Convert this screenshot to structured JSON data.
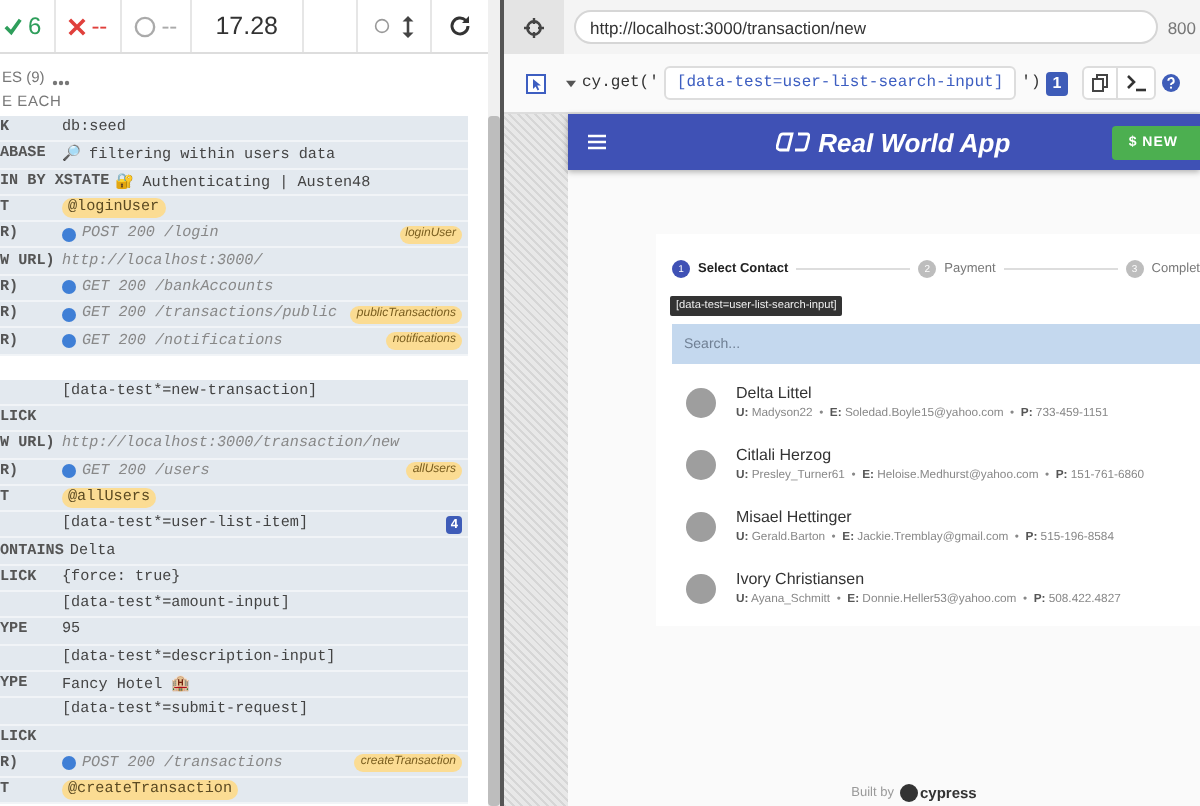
{
  "runner_bar": {
    "passed": "6",
    "failed": "--",
    "pending": "--",
    "duration": "17.28"
  },
  "command_log": {
    "section_title": "ES (9)",
    "hook_title": "E EACH",
    "groups": [
      {
        "commands": [
          {
            "kind": "plain",
            "name": "K",
            "message": "db:seed"
          },
          {
            "kind": "plain",
            "name": "ABASE",
            "message": "🔎 filtering within users data"
          },
          {
            "kind": "plain",
            "name": "IN BY XSTATE",
            "message": "🔐 Authenticating | Austen48"
          },
          {
            "kind": "alias",
            "name": "T",
            "message": "@loginUser"
          },
          {
            "kind": "xhr",
            "name": "R)",
            "message": "POST 200 /login",
            "alias": "loginUser"
          },
          {
            "kind": "url",
            "name": "W URL)",
            "message": "http://localhost:3000/"
          },
          {
            "kind": "xhr",
            "name": "R)",
            "message": "GET 200 /bankAccounts"
          },
          {
            "kind": "xhr",
            "name": "R)",
            "message": "GET 200 /transactions/public",
            "alias": "publicTransactions"
          },
          {
            "kind": "xhr",
            "name": "R)",
            "message": "GET 200 /notifications",
            "alias": "notifications"
          }
        ]
      },
      {
        "commands": [
          {
            "kind": "selector",
            "message": "[data-test*=new-transaction]"
          },
          {
            "kind": "plain",
            "name": "LICK"
          },
          {
            "kind": "url",
            "name": "W URL)",
            "message": "http://localhost:3000/transaction/new"
          },
          {
            "kind": "xhr",
            "name": "R)",
            "message": "GET 200 /users",
            "alias": "allUsers"
          },
          {
            "kind": "alias",
            "name": "T",
            "message": "@allUsers"
          },
          {
            "kind": "selector",
            "message": "[data-test*=user-list-item]",
            "count": "4"
          },
          {
            "kind": "plain",
            "name": "ONTAINS",
            "message": "Delta"
          },
          {
            "kind": "plain",
            "name": "LICK",
            "message": "{force: true}"
          },
          {
            "kind": "selector",
            "message": "[data-test*=amount-input]"
          },
          {
            "kind": "plain",
            "name": "YPE",
            "message": "95"
          },
          {
            "kind": "selector",
            "message": "[data-test*=description-input]"
          },
          {
            "kind": "plain",
            "name": "YPE",
            "message": "Fancy Hotel 🏨"
          },
          {
            "kind": "selector",
            "message": "[data-test*=submit-request]"
          },
          {
            "kind": "plain",
            "name": "LICK"
          },
          {
            "kind": "xhr",
            "name": "R)",
            "message": "POST 200 /transactions",
            "alias": "createTransaction"
          },
          {
            "kind": "alias",
            "name": "T",
            "message": "@createTransaction"
          }
        ]
      }
    ]
  },
  "aut_toolbar": {
    "url": "http://localhost:3000/transaction/new",
    "viewport": "800",
    "selector_prefix": "cy.get('",
    "selector": "[data-test=user-list-search-input]",
    "selector_suffix": "')",
    "match_count": "1"
  },
  "app": {
    "title": "Real World App",
    "new_button": "$ NEW",
    "steps": [
      {
        "number": "1",
        "label": "Select Contact",
        "selected": true
      },
      {
        "number": "2",
        "label": "Payment",
        "selected": false
      },
      {
        "number": "3",
        "label": "Complet",
        "selected": false
      }
    ],
    "tooltip": "[data-test=user-list-search-input]",
    "search": {
      "placeholder": "Search...",
      "highlighted": true
    },
    "users": [
      {
        "name": "Delta Littel",
        "details": "**U:** Madyson22  •  **E:** Soledad.Boyle15@yahoo.com  •  **P:** 733-459-1151"
      },
      {
        "name": "Citlali Herzog",
        "details": "**U:** Presley_Turner61  •  **E:** Heloise.Medhurst@yahoo.com  •  **P:** 151-761-6860"
      },
      {
        "name": "Misael Hettinger",
        "details": "**U:** Gerald.Barton  •  **E:** Jackie.Tremblay@gmail.com  •  **P:** 515-196-8584"
      },
      {
        "name": "Ivory Christiansen",
        "details": "**U:** Ayana_Schmitt  •  **E:** Donnie.Heller53@yahoo.com  •  **P:** 508.422.4827"
      }
    ],
    "footer": {
      "text": "Built by",
      "logo": "cypress"
    }
  }
}
